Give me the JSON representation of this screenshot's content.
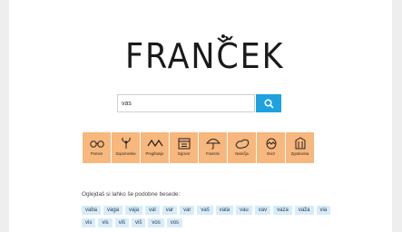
{
  "logo": {
    "text": "FRANČEK"
  },
  "search": {
    "value": "vas",
    "button_icon": "search-icon"
  },
  "categories": [
    {
      "label": "Pomen",
      "icon": "glasses-icon"
    },
    {
      "label": "Sopomenke",
      "icon": "plant-icon"
    },
    {
      "label": "Pregibanje",
      "icon": "zigzag-icon"
    },
    {
      "label": "Izgovor",
      "icon": "calendar-icon"
    },
    {
      "label": "Frazemi",
      "icon": "umbrella-icon"
    },
    {
      "label": "Narečja",
      "icon": "map-icon"
    },
    {
      "label": "Izvor",
      "icon": "egg-icon"
    },
    {
      "label": "Zgodovina",
      "icon": "monument-icon"
    }
  ],
  "similar": {
    "hint": "Oglejdaš si lahko še podobne besede:",
    "words": [
      "vaba",
      "vaga",
      "vaja",
      "val",
      "var",
      "var",
      "vaš",
      "vata",
      "vau",
      "vav",
      "vaza",
      "važa",
      "via",
      "vis",
      "vis",
      "viš",
      "viš",
      "vos",
      "vos"
    ]
  },
  "colors": {
    "accent": "#1ea1e0",
    "category_bg": "#f7b77d",
    "chip_bg": "#d7ecf8"
  }
}
